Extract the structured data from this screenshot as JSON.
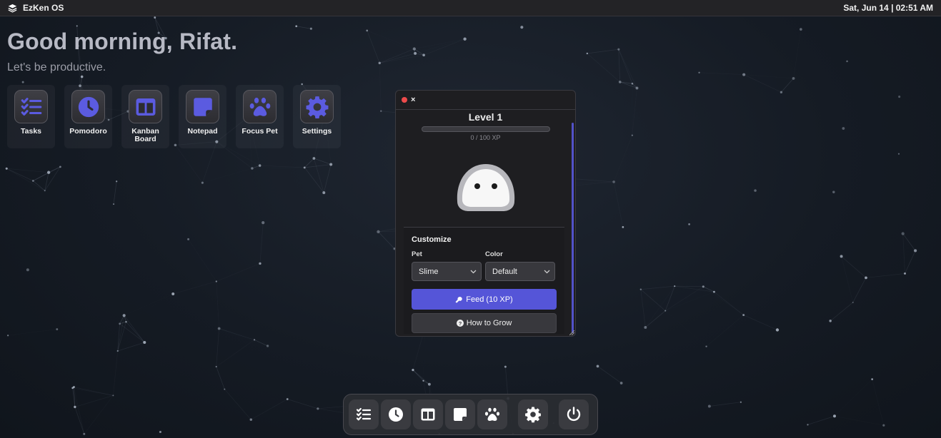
{
  "topbar": {
    "brand": "EzKen OS",
    "datetime": "Sat, Jun 14 | 02:51 AM"
  },
  "greeting": {
    "title": "Good morning, Rifat.",
    "subtitle": "Let's be productive."
  },
  "desktop_icons": [
    {
      "label": "Tasks",
      "icon": "tasks-icon"
    },
    {
      "label": "Pomodoro",
      "icon": "clock-icon"
    },
    {
      "label": "Kanban Board",
      "icon": "kanban-icon"
    },
    {
      "label": "Notepad",
      "icon": "note-icon"
    },
    {
      "label": "Focus Pet",
      "icon": "paw-icon"
    },
    {
      "label": "Settings",
      "icon": "gear-icon"
    }
  ],
  "pet_window": {
    "close_label": "×",
    "level": "Level 1",
    "xp_text": "0 / 100 XP",
    "xp_progress": 0,
    "customize_title": "Customize",
    "pet_label": "Pet",
    "pet_value": "Slime",
    "color_label": "Color",
    "color_value": "Default",
    "feed_label": "Feed (10 XP)",
    "grow_label": "How to Grow"
  },
  "dock": [
    "tasks-icon",
    "clock-icon",
    "kanban-icon",
    "note-icon",
    "paw-icon",
    "gear-icon",
    "power-icon"
  ],
  "colors": {
    "accent": "#5555d8",
    "background": "#151b24",
    "close_dot": "#ee4b4b"
  }
}
